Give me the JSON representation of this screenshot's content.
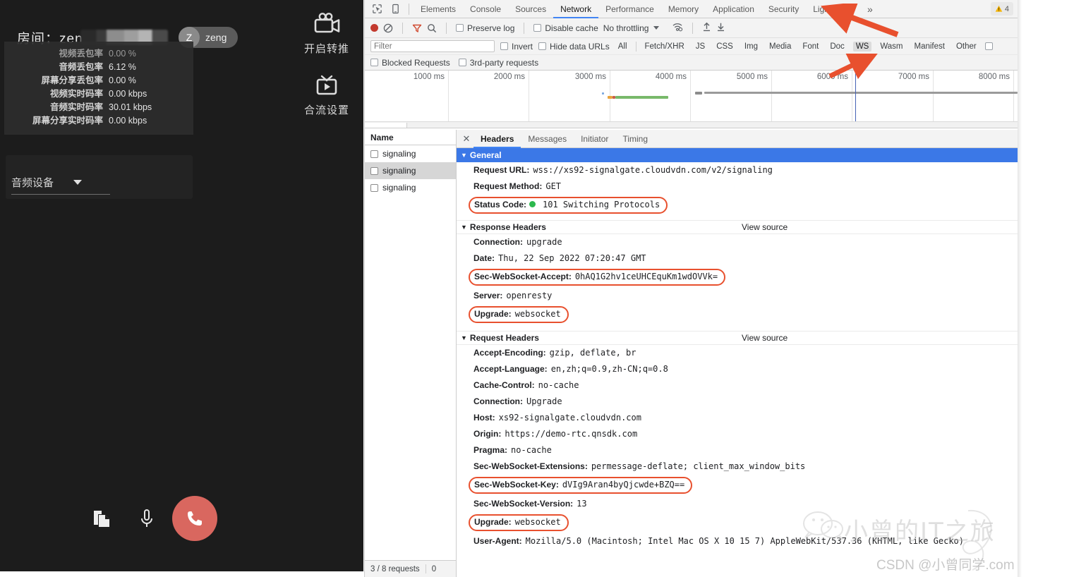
{
  "app": {
    "room_label": "房间：",
    "room_name_visible": "zen",
    "room_name_redacted": true,
    "user": {
      "initial": "Z",
      "name": "zeng"
    },
    "stats": [
      {
        "key": "视频丢包率",
        "value": "0.00 %",
        "dim": true
      },
      {
        "key": "音频丢包率",
        "value": "6.12 %",
        "dim": false
      },
      {
        "key": "屏幕分享丢包率",
        "value": "0.00 %",
        "dim": false
      },
      {
        "key": "视频实时码率",
        "value": "0.00 kbps",
        "dim": false
      },
      {
        "key": "音频实时码率",
        "value": "30.01 kbps",
        "dim": false
      },
      {
        "key": "屏幕分享实时码率",
        "value": "0.00 kbps",
        "dim": false
      }
    ],
    "audio_device_label": "音频设备",
    "side_actions": [
      {
        "icon": "video-camera-icon",
        "label": "开启转推"
      },
      {
        "icon": "tv-play-icon",
        "label": "合流设置"
      }
    ],
    "call_bar": {
      "share_icon": "screen-share-icon",
      "mic_icon": "microphone-icon",
      "hangup_icon": "phone-hangup-icon",
      "hangup_color": "#d9675f"
    }
  },
  "devtools": {
    "main_tabs": [
      {
        "label": "Elements",
        "active": false
      },
      {
        "label": "Console",
        "active": false
      },
      {
        "label": "Sources",
        "active": false
      },
      {
        "label": "Network",
        "active": true
      },
      {
        "label": "Performance",
        "active": false
      },
      {
        "label": "Memory",
        "active": false
      },
      {
        "label": "Application",
        "active": false
      },
      {
        "label": "Security",
        "active": false
      },
      {
        "label": "Lighthouse",
        "active": false
      }
    ],
    "more_tabs_glyph": "»",
    "warning_count": "4",
    "control_bar": {
      "record_label": "record-button",
      "clear_label": "clear-button",
      "filter_toggle_label": "filter-toggle",
      "search_label": "search-button",
      "preserve_log": "Preserve log",
      "preserve_log_checked": false,
      "disable_cache": "Disable cache",
      "disable_cache_checked": false,
      "throttling": "No throttling",
      "import_label": "import-har",
      "export_label": "export-har"
    },
    "filter_bar": {
      "placeholder": "Filter",
      "value": "",
      "invert": "Invert",
      "hide_data_urls": "Hide data URLs",
      "types": [
        {
          "label": "All",
          "selected": false
        },
        {
          "label": "Fetch/XHR",
          "selected": false
        },
        {
          "label": "JS",
          "selected": false
        },
        {
          "label": "CSS",
          "selected": false
        },
        {
          "label": "Img",
          "selected": false
        },
        {
          "label": "Media",
          "selected": false
        },
        {
          "label": "Font",
          "selected": false
        },
        {
          "label": "Doc",
          "selected": false
        },
        {
          "label": "WS",
          "selected": true
        },
        {
          "label": "Wasm",
          "selected": false
        },
        {
          "label": "Manifest",
          "selected": false
        },
        {
          "label": "Other",
          "selected": false
        }
      ],
      "blocked_requests": "Blocked Requests",
      "third_party": "3rd-party requests"
    },
    "overview": {
      "ticks": [
        "1000 ms",
        "2000 ms",
        "3000 ms",
        "4000 ms",
        "5000 ms",
        "6000 ms",
        "7000 ms",
        "8000 ms"
      ],
      "playhead_ms": 6050
    },
    "request_list": {
      "column_header": "Name",
      "rows": [
        {
          "name": "signaling",
          "selected": false
        },
        {
          "name": "signaling",
          "selected": true
        },
        {
          "name": "signaling",
          "selected": false
        }
      ],
      "status": {
        "requests": "3 / 8 requests",
        "transferred": "0 "
      }
    },
    "detail_tabs": [
      {
        "label": "Headers",
        "active": true
      },
      {
        "label": "Messages",
        "active": false
      },
      {
        "label": "Initiator",
        "active": false
      },
      {
        "label": "Timing",
        "active": false
      }
    ],
    "sections": {
      "general": {
        "title": "General",
        "rows": [
          {
            "key": "Request URL:",
            "value": "wss://xs92-signalgate.cloudvdn.com/v2/signaling",
            "boxed": false
          },
          {
            "key": "Request Method:",
            "value": "GET",
            "boxed": false
          },
          {
            "key": "Status Code:",
            "value": "101 Switching Protocols",
            "boxed": true,
            "dot": "#2db84d"
          }
        ]
      },
      "response_headers": {
        "title": "Response Headers",
        "view_source": "View source",
        "rows": [
          {
            "key": "Connection:",
            "value": "upgrade",
            "boxed": false
          },
          {
            "key": "Date:",
            "value": "Thu, 22 Sep 2022 07:20:47 GMT",
            "boxed": false
          },
          {
            "key": "Sec-WebSocket-Accept:",
            "value": "0hAQ1G2hv1ceUHCEquKm1wdOVVk=",
            "boxed": true
          },
          {
            "key": "Server:",
            "value": "openresty",
            "boxed": false
          },
          {
            "key": "Upgrade:",
            "value": "websocket",
            "boxed": true
          }
        ]
      },
      "request_headers": {
        "title": "Request Headers",
        "view_source": "View source",
        "rows": [
          {
            "key": "Accept-Encoding:",
            "value": "gzip, deflate, br",
            "boxed": false
          },
          {
            "key": "Accept-Language:",
            "value": "en,zh;q=0.9,zh-CN;q=0.8",
            "boxed": false
          },
          {
            "key": "Cache-Control:",
            "value": "no-cache",
            "boxed": false
          },
          {
            "key": "Connection:",
            "value": "Upgrade",
            "boxed": false
          },
          {
            "key": "Host:",
            "value": "xs92-signalgate.cloudvdn.com",
            "boxed": false
          },
          {
            "key": "Origin:",
            "value": "https://demo-rtc.qnsdk.com",
            "boxed": false
          },
          {
            "key": "Pragma:",
            "value": "no-cache",
            "boxed": false
          },
          {
            "key": "Sec-WebSocket-Extensions:",
            "value": "permessage-deflate; client_max_window_bits",
            "boxed": false
          },
          {
            "key": "Sec-WebSocket-Key:",
            "value": "dVIg9Aran4byQjcwde+BZQ==",
            "boxed": true
          },
          {
            "key": "Sec-WebSocket-Version:",
            "value": "13",
            "boxed": false
          },
          {
            "key": "Upgrade:",
            "value": "websocket",
            "boxed": true
          },
          {
            "key": "User-Agent:",
            "value": "Mozilla/5.0 (Macintosh; Intel Mac OS X 10 15 7) AppleWebKit/537.36 (KHTML, like Gecko)",
            "boxed": false
          }
        ]
      }
    }
  },
  "annotations": {
    "arrow_color": "#e8502e",
    "arrows": [
      {
        "name": "arrow-to-network-tab",
        "target": "Network"
      },
      {
        "name": "arrow-to-ws-filter",
        "target": "WS"
      }
    ]
  },
  "watermark": {
    "brand": "小曾的IT之旅",
    "credit": "CSDN @小曾同学.com",
    "logo": "wechat-logo"
  }
}
